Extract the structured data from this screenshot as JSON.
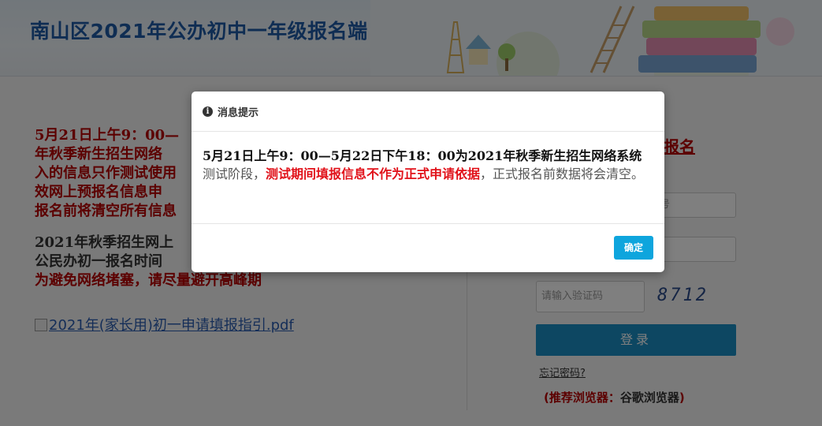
{
  "header": {
    "title": "南山区2021年公办初中一年级报名端"
  },
  "notice": {
    "line1": "5月21日上午9：00—",
    "line2": "年秋季新生招生网络",
    "line3": "入的信息只作测试使用",
    "line4": "效网上预报名信息申",
    "line5": "报名前将清空所有信息",
    "line6": "2021年秋季招生网上",
    "line7": "公民办初一报名时间",
    "line8": "为避免网络堵塞，请尽量避开高峰期"
  },
  "guide_link": "2021年(家长用)初一申请填报指引.pdf",
  "login": {
    "link_label": "报名",
    "field1_placeholder": "号",
    "captcha_placeholder": "请输入验证码",
    "captcha_code": "8712",
    "submit_label": "登录",
    "forgot_label": "忘记密码?",
    "browser_label": "(推荐浏览器：",
    "browser_value": "谷歌浏览器",
    "browser_close": ")"
  },
  "modal": {
    "icon": "info-icon",
    "title": "消息提示",
    "body_part1": "5月21日上午9：00—5月22日下午18：00为2021年秋季新生招生网络系统",
    "body_part2": "测试阶段，",
    "body_part3": "测试期间填报信息不作为正式申请依据",
    "body_part4": "，正式报名前数据将会清空。",
    "ok_label": "确定"
  },
  "colors": {
    "brand_blue": "#1f5aa6",
    "alert_red": "#b80000",
    "button_blue": "#0ea5dd",
    "login_button": "#1b8fc4"
  }
}
